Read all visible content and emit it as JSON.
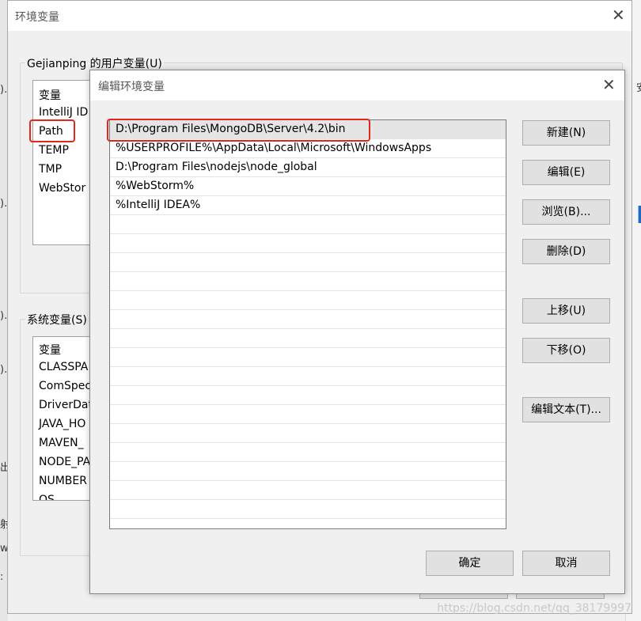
{
  "outer_dialog": {
    "title": "环境变量",
    "user_group_label": "Gejianping 的用户变量(U)",
    "user_vars": {
      "header": "变量",
      "items": [
        "IntelliJ ID",
        "Path",
        "TEMP",
        "TMP",
        "WebStor"
      ]
    },
    "system_group_label": "系统变量(S)",
    "system_vars": {
      "header": "变量",
      "items": [
        "CLASSPA",
        "ComSpec",
        "DriverDat",
        "JAVA_HO",
        "MAVEN_",
        "NODE_PA",
        "NUMBER",
        "OS"
      ]
    }
  },
  "background_fragments": {
    "f1": ")..",
    "f2": ").",
    "f3": ")..",
    "f4": ")..",
    "f5": "出",
    "f6": "射",
    "f7": "w",
    "f8": ":",
    "right_edge": "安",
    "right_glyph": "r"
  },
  "edit_dialog": {
    "title": "编辑环境变量",
    "paths": [
      "D:\\Program Files\\MongoDB\\Server\\4.2\\bin",
      "%USERPROFILE%\\AppData\\Local\\Microsoft\\WindowsApps",
      "D:\\Program Files\\nodejs\\node_global",
      "%WebStorm%",
      "%IntelliJ IDEA%"
    ],
    "buttons": {
      "new": "新建(N)",
      "edit": "编辑(E)",
      "browse": "浏览(B)...",
      "delete": "删除(D)",
      "move_up": "上移(U)",
      "move_down": "下移(O)",
      "edit_text": "编辑文本(T)...",
      "ok": "确定",
      "cancel": "取消"
    }
  },
  "watermark": "https://blog.csdn.net/qq_38179997",
  "colors": {
    "highlight_box": "#e0271c",
    "selected_row": "#e5e5e5",
    "button_face": "#e1e1e1"
  }
}
